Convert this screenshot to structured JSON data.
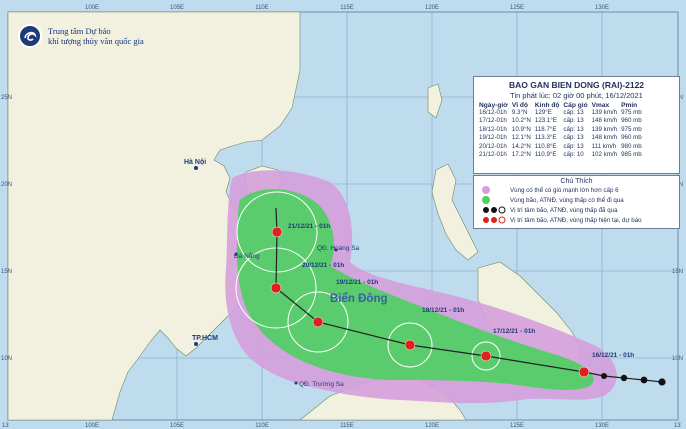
{
  "agency": {
    "line1": "Trung tâm Dự báo",
    "line2": "khí tượng thủy văn quốc gia",
    "logo_icon": "globe-swirl-icon"
  },
  "grid": {
    "top_labels": [
      "100E",
      "105E",
      "110E",
      "115E",
      "120E",
      "125E",
      "130E"
    ],
    "bottom_labels": [
      "100E",
      "105E",
      "110E",
      "115E",
      "120E",
      "125E",
      "130E"
    ],
    "left_labels": [
      "25N",
      "20N",
      "15N",
      "10N"
    ],
    "right_labels": [
      "25N",
      "20N",
      "15N",
      "10N"
    ],
    "corner_labels": [
      "13",
      "13"
    ]
  },
  "places": {
    "hanoi": "Hà Nội",
    "danang": "Đà Nẵng",
    "hcm": "TP.HCM",
    "hoangsa": "QĐ. Hoàng Sa",
    "truongsa": "QĐ. Trường Sa",
    "sea": "Biển Đông"
  },
  "track_labels": [
    "21/12/21 - 01h",
    "20/12/21 - 01h",
    "19/12/21 - 01h",
    "18/12/21 - 01h",
    "17/12/21 - 01h",
    "16/12/21 - 01h"
  ],
  "info": {
    "title": "BAO GAN BIEN DONG (RAI)-2122",
    "issued": "Tin phát lúc: 02 giờ 00 phút, 16/12/2021",
    "headers": [
      "Ngày-giờ",
      "Vĩ độ",
      "Kinh độ",
      "Cấp gió",
      "Vmax",
      "Pmin"
    ],
    "rows": [
      [
        "16/12-01h",
        "9.3°N",
        "129°E",
        "cấp: 13",
        "139 km/h",
        "975 mb"
      ],
      [
        "17/12-01h",
        "10.2°N",
        "123.1°E",
        "cấp: 13",
        "148 km/h",
        "960 mb"
      ],
      [
        "18/12-01h",
        "10.9°N",
        "118.7°E",
        "cấp: 13",
        "139 km/h",
        "975 mb"
      ],
      [
        "19/12-01h",
        "12.1°N",
        "113.3°E",
        "cấp: 13",
        "148 km/h",
        "960 mb"
      ],
      [
        "20/12-01h",
        "14.2°N",
        "110.8°E",
        "cấp: 13",
        "111 km/h",
        "980 mb"
      ],
      [
        "21/12-01h",
        "17.2°N",
        "110.9°E",
        "cấp: 10",
        "102 km/h",
        "985 mb"
      ]
    ]
  },
  "legend": {
    "title": "Chú Thích",
    "items": [
      {
        "text": "Vùng có thể có gió mạnh lớn hơn cấp 6",
        "color": "#d59fdc"
      },
      {
        "text": "Vùng bão, ATNĐ, vùng thấp có thể đi qua",
        "color": "#4fcf63"
      },
      {
        "text": "Vị trí tâm bão, ATNĐ, vùng thấp đã qua",
        "color": "#111111"
      },
      {
        "text": "Vị trí tâm bão, ATNĐ, vùng thấp hiện tại, dự báo",
        "color": "#e0201c"
      }
    ]
  },
  "colors": {
    "sea": "#bfdcee",
    "land": "#f2f0df",
    "wind_zone": "#d59fdc",
    "storm_zone": "#4fcf63",
    "track": "#222222",
    "current_symbol": "#e0201c",
    "past_symbol": "#111111"
  }
}
